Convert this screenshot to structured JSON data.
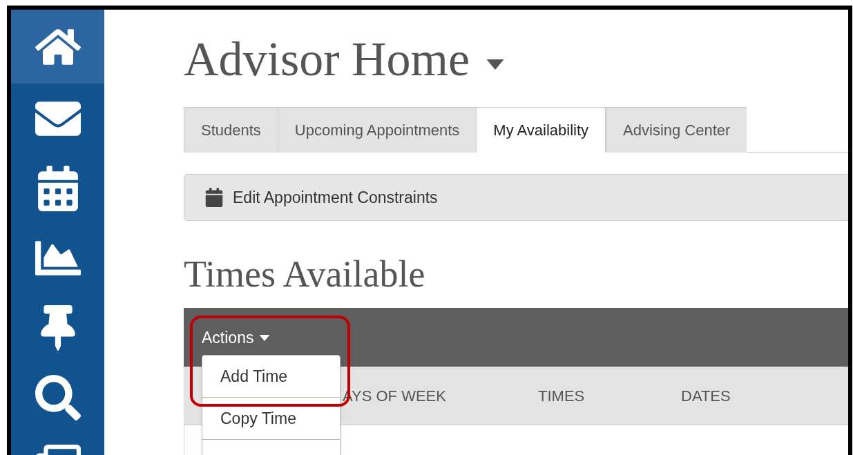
{
  "sidebar": {
    "items": [
      {
        "selected": true
      },
      {
        "selected": false
      },
      {
        "selected": false
      },
      {
        "selected": false
      },
      {
        "selected": false
      },
      {
        "selected": false
      },
      {
        "selected": false
      }
    ]
  },
  "page": {
    "title": "Advisor Home"
  },
  "tabs": [
    {
      "label": "Students",
      "selected": false
    },
    {
      "label": "Upcoming Appointments",
      "selected": false
    },
    {
      "label": "My Availability",
      "selected": true
    },
    {
      "label": "Advising Center",
      "selected": false
    }
  ],
  "toolbar": {
    "button": "Edit Appointment Constraints"
  },
  "section": {
    "title": "Times Available"
  },
  "table": {
    "actions": "Actions",
    "columns": [
      "AYS OF WEEK",
      "TIMES",
      "DATES"
    ]
  },
  "actions_menu": {
    "items": [
      "Add Time",
      "Copy Time"
    ]
  }
}
